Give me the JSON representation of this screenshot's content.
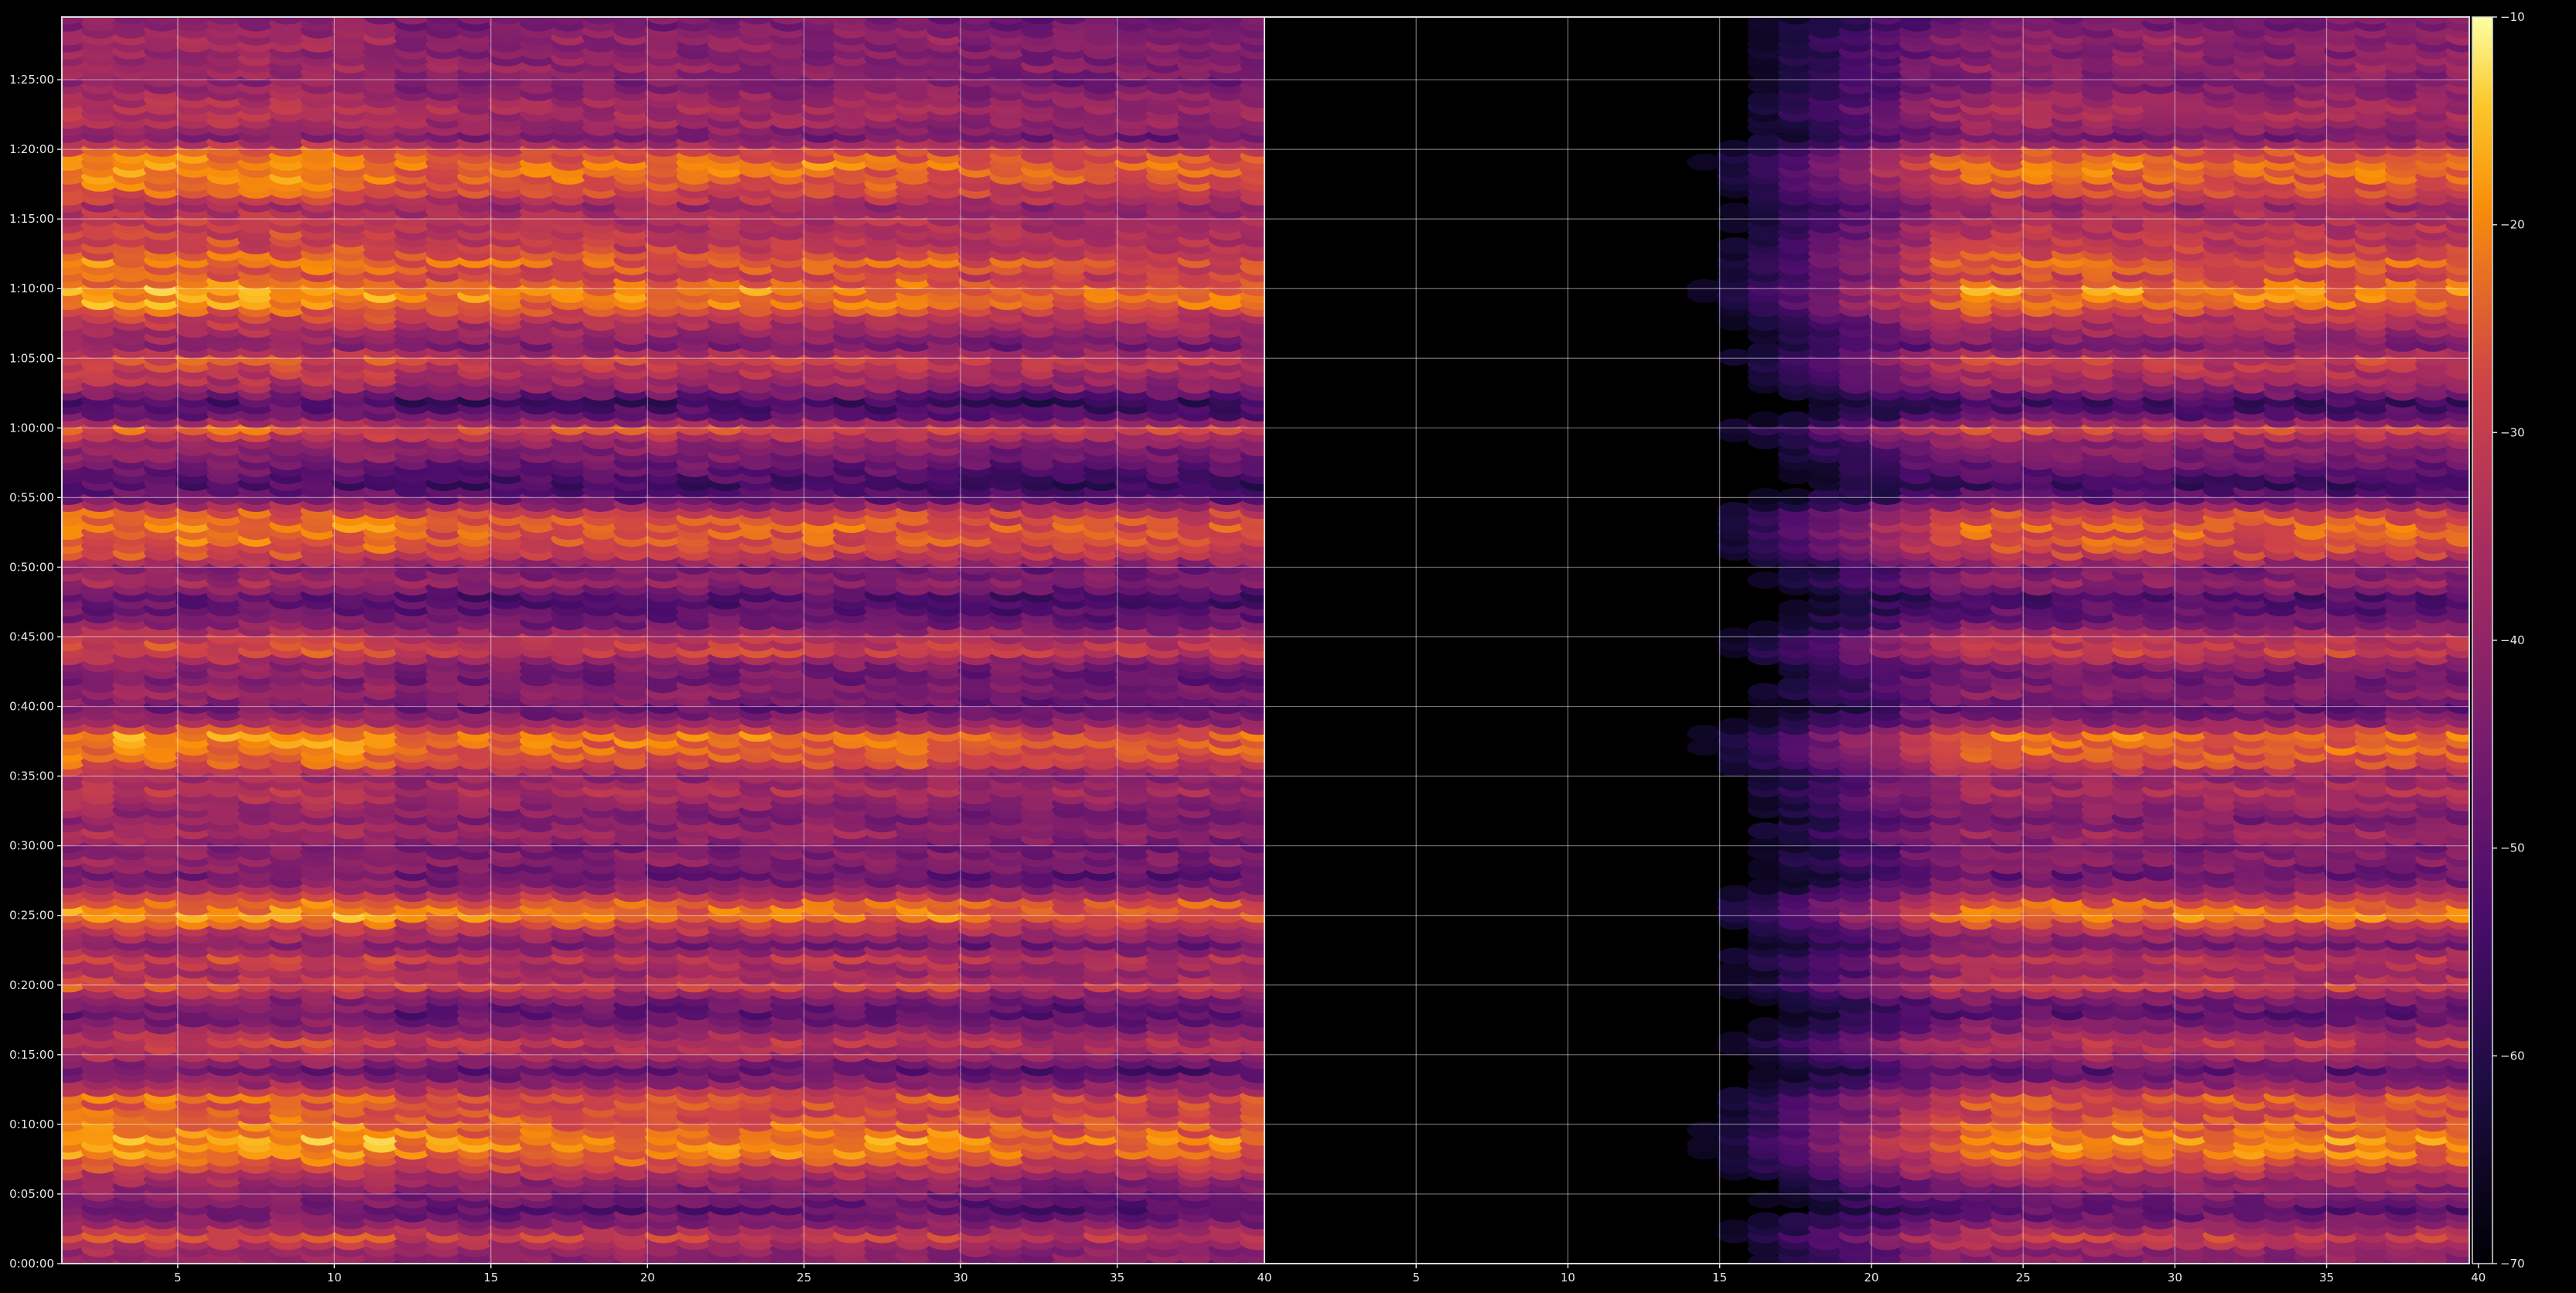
{
  "chart_data": {
    "type": "heatmap",
    "title": "",
    "xlabel": "",
    "ylabel": "",
    "grid": true,
    "legend": "colorbar-right",
    "colormap": "inferno",
    "panels": [
      {
        "name": "",
        "xlim": [
          1.3,
          39.7
        ],
        "x_ticks": [
          5,
          10,
          15,
          20,
          25,
          30,
          35
        ],
        "x_tick_labels": [
          "5",
          "10",
          "15",
          "20",
          "25",
          "30",
          "35"
        ],
        "x_cells": [
          1.5,
          40
        ]
      },
      {
        "name": "",
        "xlim": [
          0,
          39.7
        ],
        "x_ticks": [
          5,
          10,
          15,
          20,
          25,
          30,
          35,
          40
        ],
        "x_tick_labels": [
          "5",
          "10",
          "15",
          "20",
          "25",
          "30",
          "35",
          "40"
        ],
        "x_cells": [
          0.5,
          40
        ],
        "left_edge_label": "40"
      }
    ],
    "y_axis": {
      "unit": "time (h:mm:ss)",
      "ylim_seconds": [
        0,
        5370
      ],
      "tick_seconds": [
        0,
        300,
        600,
        900,
        1200,
        1500,
        1800,
        2100,
        2400,
        2700,
        3000,
        3300,
        3600,
        3900,
        4200,
        4500,
        4800,
        5100
      ],
      "tick_labels": [
        "0:00:00",
        "0:05:00",
        "0:10:00",
        "0:15:00",
        "0:20:00",
        "0:25:00",
        "0:30:00",
        "0:35:00",
        "0:40:00",
        "0:45:00",
        "0:50:00",
        "0:55:00",
        "1:00:00",
        "1:05:00",
        "1:10:00",
        "1:15:00",
        "1:20:00",
        "1:25:00"
      ]
    },
    "row_spacing_seconds": 60,
    "colorbar": {
      "min": -70,
      "max": -10,
      "ticks": [
        -70,
        -60,
        -50,
        -40,
        -30,
        -20,
        -10
      ],
      "tick_labels": [
        "−70",
        "−60",
        "−50",
        "−40",
        "−30",
        "−20",
        "−10"
      ]
    },
    "intensity_profile": {
      "time_seconds": [
        0,
        60,
        120,
        180,
        240,
        300,
        360,
        420,
        480,
        540,
        600,
        660,
        720,
        780,
        840,
        900,
        960,
        1020,
        1080,
        1140,
        1200,
        1260,
        1320,
        1380,
        1440,
        1500,
        1560,
        1620,
        1680,
        1740,
        1800,
        1860,
        1920,
        1980,
        2040,
        2100,
        2160,
        2220,
        2280,
        2340,
        2400,
        2460,
        2520,
        2580,
        2640,
        2700,
        2760,
        2820,
        2880,
        2940,
        3000,
        3060,
        3120,
        3180,
        3240,
        3300,
        3360,
        3420,
        3480,
        3540,
        3600,
        3660,
        3720,
        3780,
        3840,
        3900,
        3960,
        4020,
        4080,
        4140,
        4200,
        4260,
        4320,
        4380,
        4440,
        4500,
        4560,
        4620,
        4680,
        4740,
        4800,
        4860,
        4920,
        4980,
        5040,
        5100,
        5160,
        5220,
        5280,
        5340
      ],
      "level_db": [
        -42,
        -40,
        -30,
        -42,
        -50,
        -45,
        -40,
        -30,
        -22,
        -20,
        -24,
        -28,
        -26,
        -40,
        -50,
        -38,
        -32,
        -42,
        -50,
        -45,
        -30,
        -38,
        -32,
        -45,
        -34,
        -22,
        -24,
        -40,
        -48,
        -42,
        -45,
        -38,
        -44,
        -40,
        -35,
        -40,
        -28,
        -24,
        -22,
        -40,
        -48,
        -42,
        -46,
        -44,
        -30,
        -32,
        -45,
        -50,
        -52,
        -40,
        -45,
        -30,
        -26,
        -24,
        -28,
        -48,
        -55,
        -50,
        -45,
        -40,
        -28,
        -50,
        -55,
        -40,
        -34,
        -30,
        -44,
        -38,
        -32,
        -22,
        -20,
        -28,
        -24,
        -30,
        -32,
        -34,
        -38,
        -28,
        -24,
        -22,
        -28,
        -45,
        -38,
        -36,
        -40,
        -44,
        -40,
        -42,
        -40,
        -45
      ]
    }
  }
}
